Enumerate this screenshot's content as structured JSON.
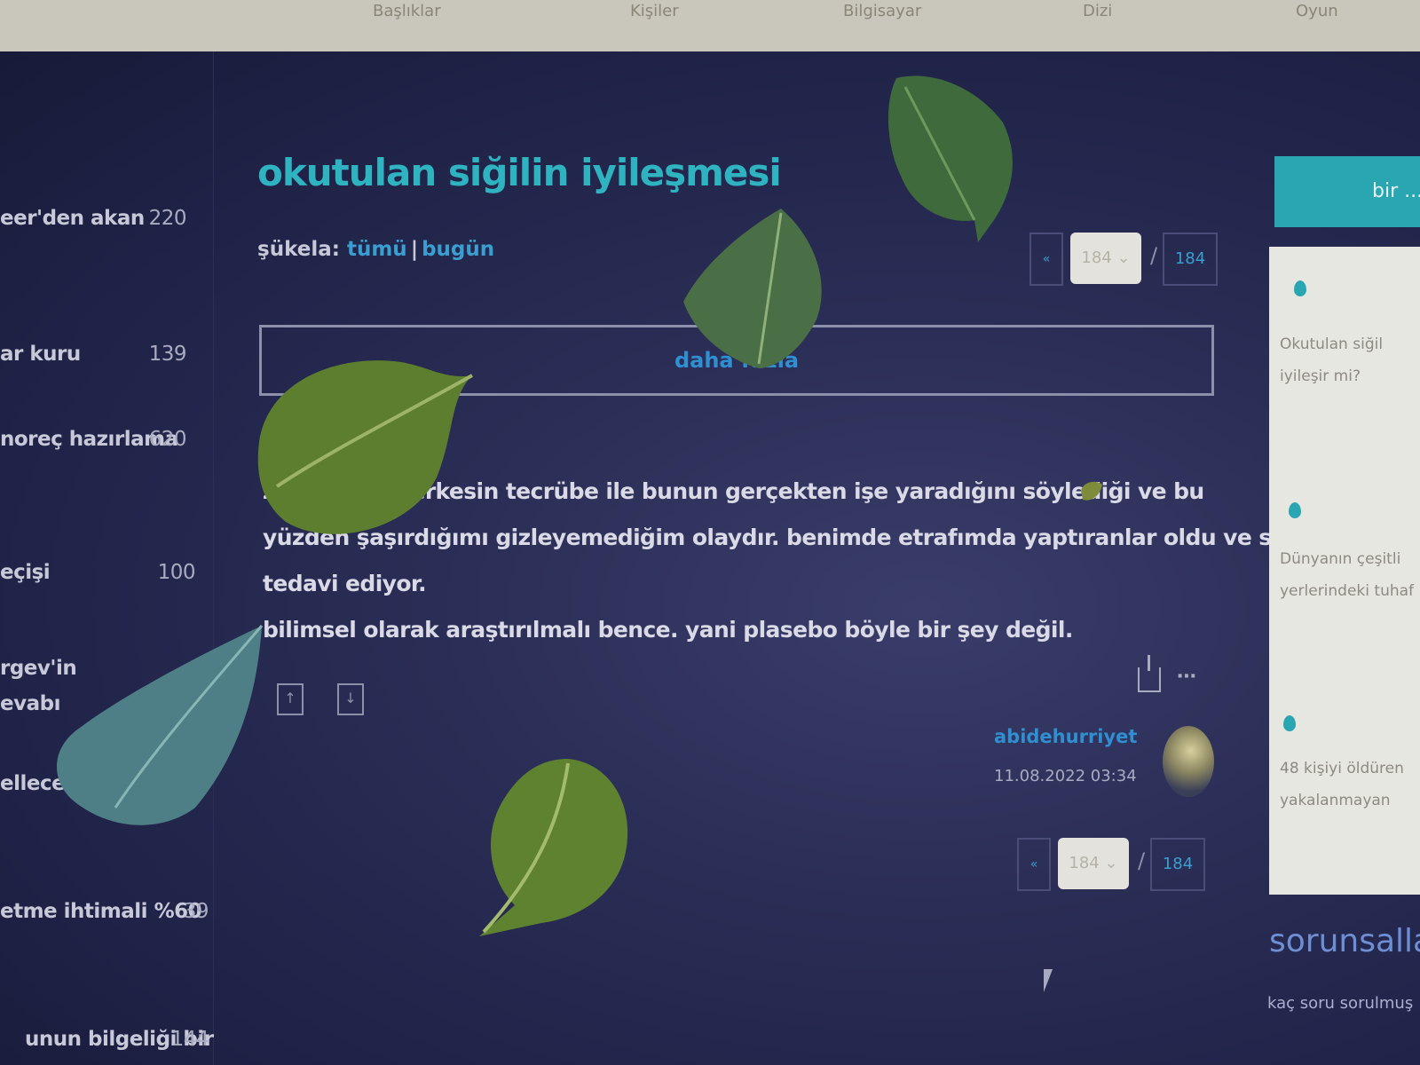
{
  "browser": {
    "tabs": [
      "Başlıklar",
      "Kişiler",
      "Bilgisayar",
      "Dizi",
      "Oyun"
    ]
  },
  "sidebar": {
    "items": [
      {
        "label": "eer'den akan",
        "count": "220"
      },
      {
        "label": "ar kuru",
        "count": "139"
      },
      {
        "label": "noreç hazırlama",
        "count": "620"
      },
      {
        "label": "eçişi",
        "count": "100"
      },
      {
        "label": "rgev'in evabı",
        "count": ""
      },
      {
        "label": "elleceğ",
        "count": ""
      },
      {
        "label": "etme ihtimali %60",
        "count": "39"
      },
      {
        "label": "unun bilgeliği bir",
        "count": "144"
      }
    ]
  },
  "topic": {
    "title": "okutulan siğilin iyileşmesi",
    "filters_label": "şükela:",
    "filter_all": "tümü",
    "filter_today": "bugün",
    "more_entries": "daha fazla",
    "entry_lines": [
      "zine kadar herkesin tecrübe ile bunun gerçekten işe yaradığını söylediği ve bu",
      "yüzden şaşırdığımı gizleyemediğim olaydır. benimde etrafımda yaptıranlar oldu ve sonuç kesin,",
      "tedavi ediyor.",
      "bilimsel olarak araştırılmalı bence. yani plasebo böyle bir şey değil."
    ],
    "author": "abidehurriyet",
    "date": "11.08.2022 03:34",
    "upvote_icon": "arrow-up-icon",
    "downvote_icon": "arrow-down-icon"
  },
  "pager_top": {
    "prev": "«",
    "current": "184",
    "slash": "/",
    "total": "184"
  },
  "pager_bottom": {
    "prev": "«",
    "current": "184",
    "slash": "/",
    "total": "184"
  },
  "right_panel": {
    "header": "bir ...",
    "items": [
      {
        "text": "Okutulan siğil iyileşir mi?"
      },
      {
        "text": "Dünyanın çeşitli yerlerindeki tuhaf"
      },
      {
        "text": "48 kişiyi öldüren yakalanmayan"
      }
    ],
    "footer_title": "sorunsallar",
    "footer_text": "kaç soru sorulmuş"
  },
  "colors": {
    "background": "#1e2140",
    "title": "#2fb3c0",
    "link": "#3a9fd0",
    "text": "#d9dae6",
    "panel_accent": "#2aa6b3"
  }
}
